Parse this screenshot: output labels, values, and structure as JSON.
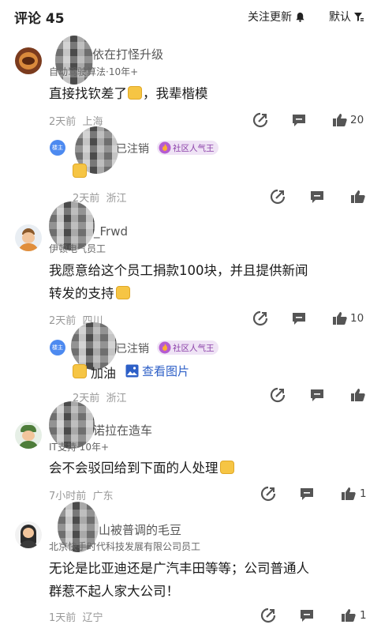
{
  "header": {
    "title": "评论 45",
    "follow_label": "关注更新",
    "sort_label": "默认"
  },
  "comments": [
    {
      "name": "依在打怪升级",
      "subtitle": "自动驾驶算法·10年+",
      "text_lines": [
        "直接找钦差了"
      ],
      "text_tail": "，我辈楷模",
      "time": "2天前",
      "location": "上海",
      "likes": "20",
      "reply": {
        "host_label": "楼主",
        "name": "已注销",
        "badge": "社区人气王",
        "time": "2天前",
        "location": "浙江"
      }
    },
    {
      "name": "_Frwd",
      "subtitle": "伊顿电气员工",
      "text_lines": [
        "我愿意给这个员工捐款100块，并且提供新闻",
        "转发的支持"
      ],
      "time": "2天前",
      "location": "四川",
      "likes": "10",
      "reply": {
        "host_label": "楼主",
        "name": "已注销",
        "badge": "社区人气王",
        "text": "加油",
        "image_link": "查看图片",
        "time": "2天前",
        "location": "浙江"
      }
    },
    {
      "name": "诺拉在造车",
      "subtitle": "IT支持·10年+",
      "text_lines": [
        "会不会驳回给到下面的人处理"
      ],
      "time": "7小时前",
      "location": "广东",
      "likes": "1"
    },
    {
      "name": "山被普调的毛豆",
      "subtitle": "北京快手时代科技发展有限公司员工",
      "text_lines": [
        "无论是比亚迪还是广汽丰田等等；公司普通人",
        "群惹不起人家大公司！"
      ],
      "time": "1天前",
      "location": "辽宁",
      "likes": "1"
    }
  ],
  "colors": {
    "accent_blue": "#2d5fc7",
    "host_badge": "#4d8af0",
    "badge_purple": "#8a3fa8"
  },
  "icons": [
    "bell-icon",
    "filter-icon",
    "share-icon",
    "comment-icon",
    "thumbs-up-icon",
    "image-icon",
    "fire-icon"
  ]
}
